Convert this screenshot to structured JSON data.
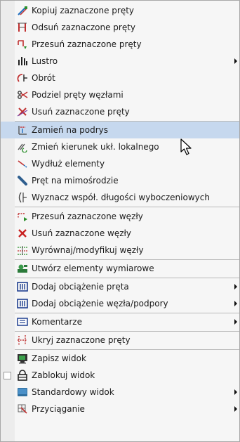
{
  "menu": {
    "items": [
      {
        "label": "Kopiuj zaznaczone pręty",
        "icon": "copy-bars-icon"
      },
      {
        "label": "Odsuń zaznaczone pręty",
        "icon": "offset-bars-icon"
      },
      {
        "label": "Przesuń zaznaczone pręty",
        "icon": "move-bars-icon"
      },
      {
        "label": "Lustro",
        "icon": "mirror-icon",
        "submenu": true
      },
      {
        "label": "Obrót",
        "icon": "rotate-icon"
      },
      {
        "label": "Podziel pręty węzłami",
        "icon": "divide-bars-icon"
      },
      {
        "label": "Usuń zaznaczone pręty",
        "icon": "delete-bars-icon"
      },
      {
        "label": "Zamień na podrys",
        "icon": "convert-to-underlay-icon",
        "highlighted": true
      },
      {
        "label": "Zmień kierunek ukł. lokalnego",
        "icon": "change-direction-icon"
      },
      {
        "label": "Wydłuż elementy",
        "icon": "extend-elements-icon"
      },
      {
        "label": "Pręt na mimośrodzie",
        "icon": "eccentric-bar-icon"
      },
      {
        "label": "Wyznacz współ. długości wyboczeniowych",
        "icon": "buckling-length-icon"
      },
      {
        "label": "Przesuń zaznaczone węzły",
        "icon": "move-nodes-icon"
      },
      {
        "label": "Usuń zaznaczone węzły",
        "icon": "delete-nodes-icon"
      },
      {
        "label": "Wyrównaj/modyfikuj węzły",
        "icon": "align-nodes-icon"
      },
      {
        "label": "Utwórz elementy wymiarowe",
        "icon": "dimension-elements-icon"
      },
      {
        "label": "Dodaj obciążenie pręta",
        "icon": "bar-load-icon",
        "submenu": true
      },
      {
        "label": "Dodaj obciążenie węzła/podpory",
        "icon": "node-load-icon",
        "submenu": true
      },
      {
        "label": "Komentarze",
        "icon": "comments-icon",
        "submenu": true
      },
      {
        "label": "Ukryj zaznaczone pręty",
        "icon": "hide-bars-icon"
      },
      {
        "label": "Zapisz widok",
        "icon": "save-view-icon"
      },
      {
        "label": "Zablokuj widok",
        "icon": "lock-view-icon",
        "checkbox": true,
        "checked": false
      },
      {
        "label": "Standardowy widok",
        "icon": "standard-view-icon",
        "submenu": true
      },
      {
        "label": "Przyciąganie",
        "icon": "snapping-icon",
        "submenu": true
      }
    ]
  }
}
